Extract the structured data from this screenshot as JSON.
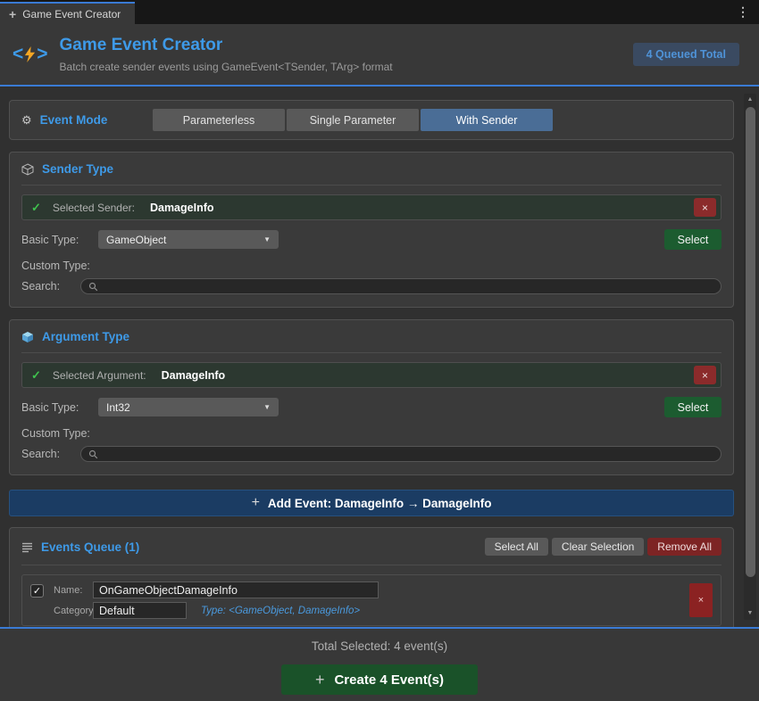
{
  "window": {
    "tab_title": "Game Event Creator",
    "menu_icon": "⋮",
    "tab_plus_icon": "+"
  },
  "header": {
    "title": "Game Event Creator",
    "subtitle": "Batch create sender events using GameEvent<TSender, TArg> format",
    "badge": "4 Queued Total"
  },
  "icons": {
    "gear": "⚙",
    "check": "✓",
    "close": "×",
    "plus": "+",
    "dropdown_arrow": "▼",
    "scroll_up": "▲",
    "scroll_down": "▼",
    "bracket_left": "<",
    "bracket_right": ">"
  },
  "event_mode": {
    "title": "Event Mode",
    "options": [
      {
        "label": "Parameterless",
        "selected": false
      },
      {
        "label": "Single Parameter",
        "selected": false
      },
      {
        "label": "With Sender",
        "selected": true
      }
    ]
  },
  "sender_type": {
    "title": "Sender Type",
    "selected_label": "Selected Sender:",
    "selected_value": "DamageInfo",
    "basic_type_label": "Basic Type:",
    "basic_type_value": "GameObject",
    "select_button": "Select",
    "custom_type_label": "Custom Type:",
    "search_label": "Search:",
    "search_value": ""
  },
  "argument_type": {
    "title": "Argument Type",
    "selected_label": "Selected Argument:",
    "selected_value": "DamageInfo",
    "basic_type_label": "Basic Type:",
    "basic_type_value": "Int32",
    "select_button": "Select",
    "custom_type_label": "Custom Type:",
    "search_label": "Search:",
    "search_value": ""
  },
  "add_event": {
    "label": "Add Event: DamageInfo → DamageInfo"
  },
  "events_queue": {
    "title": "Events Queue (1)",
    "select_all": "Select All",
    "clear_selection": "Clear Selection",
    "remove_all": "Remove All",
    "items": [
      {
        "checked": true,
        "name_label": "Name:",
        "name": "OnGameObjectDamageInfo",
        "category_label": "Category",
        "category": "Default",
        "type_text": "Type: <GameObject, DamageInfo>"
      }
    ]
  },
  "footer": {
    "total_text": "Total Selected: 4 event(s)",
    "create_button": "Create 4 Event(s)"
  },
  "colors": {
    "accent_blue": "#3e9ae8",
    "tab_highlight": "#3a7bd5",
    "selected_mode": "#4a6d96",
    "success_green": "#1c5c30",
    "check_green": "#3fc24e",
    "danger_red": "#8b2b2b",
    "remove_red": "#7d2424",
    "add_event_navy": "#1b3c63",
    "badge_bg": "#3a4a61",
    "bolt_orange": "#f5a623"
  }
}
